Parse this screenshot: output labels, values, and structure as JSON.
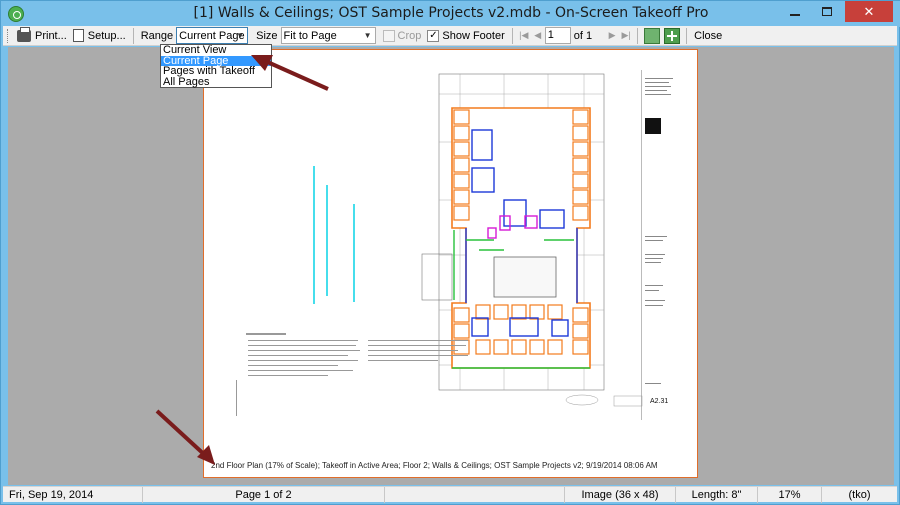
{
  "window": {
    "title": "[1] Walls & Ceilings; OST Sample Projects v2.mdb - On-Screen Takeoff Pro",
    "close_glyph": "✕"
  },
  "toolbar": {
    "print_label": "Print...",
    "setup_label": "Setup...",
    "range_label": "Range",
    "range_value": "Current Page",
    "size_label": "Size",
    "size_value": "Fit to Page",
    "crop_label": "Crop",
    "show_footer_label": "Show Footer",
    "page_value": "1",
    "page_of": "of 1",
    "close_label": "Close",
    "check_glyph": "✓"
  },
  "range_options": [
    "Current View",
    "Current Page",
    "Pages with Takeoff",
    "All Pages"
  ],
  "range_selected_index": 1,
  "preview": {
    "footer_caption": "2nd Floor Plan (17% of Scale); Takeoff in Active Area; Floor 2; Walls & Ceilings; OST Sample Projects v2; 9/19/2014 08:06 AM",
    "sheet_number": "A2.31"
  },
  "statusbar": {
    "date": "Fri, Sep 19, 2014",
    "page": "Page 1 of 2",
    "image": "Image (36 x 48)",
    "length": "Length: 8\"",
    "zoom": "17%",
    "mode": "(tko)"
  },
  "colors": {
    "titlebar": "#79c0ea",
    "paper_border": "#e06d2a",
    "preview_bg": "#ababab",
    "close_button": "#c7403a",
    "annotation_arrow": "#7a1c1c"
  }
}
